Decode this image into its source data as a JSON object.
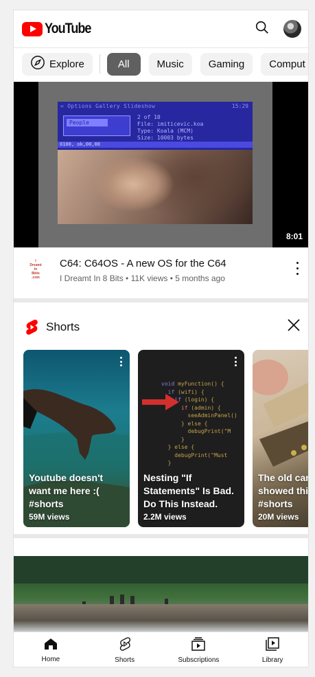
{
  "header": {
    "logo_text": "YouTube",
    "brand_color": "#ff0000",
    "search_icon": "search-icon",
    "account_icon": "avatar"
  },
  "chips": {
    "explore": "Explore",
    "items": [
      "All",
      "Music",
      "Gaming",
      "Comput"
    ],
    "active_index": 0
  },
  "featured_video": {
    "duration": "8:01",
    "title": "C64: C64OS - A new OS for the C64",
    "channel": "I Dreamt In 8 Bits",
    "views": "11K views",
    "age": "5 months ago",
    "subtitle": "I Dreamt In 8 Bits • 11K views • 5 months ago",
    "channel_avatar_lines": [
      "I",
      "Dreamt",
      "In",
      "8bits",
      ".com"
    ],
    "thumbnail": {
      "title": "= Options Gallery Slideshow",
      "time": "15:29",
      "box_label": "People",
      "lines": [
        "2  of 10",
        "File: imiticevic.koa",
        "Type: Koala (MCM)",
        "Size: 10003 bytes"
      ],
      "bar": "0100, ok,00,00"
    }
  },
  "shorts": {
    "section_title": "Shorts",
    "items": [
      {
        "title": "Youtube doesn't\nwant me here :(\n#shorts",
        "views": "59M views"
      },
      {
        "title": "Nesting \"If\nStatements\" Is Bad.\nDo This Instead.",
        "views": "2.2M views"
      },
      {
        "title": "The old car\nshowed this\n#shorts",
        "views": "20M views"
      }
    ]
  },
  "bottom_nav": {
    "items": [
      {
        "label": "Home",
        "icon": "home-icon"
      },
      {
        "label": "Shorts",
        "icon": "shorts-icon"
      },
      {
        "label": "Subscriptions",
        "icon": "subscriptions-icon"
      },
      {
        "label": "Library",
        "icon": "library-icon"
      }
    ]
  }
}
